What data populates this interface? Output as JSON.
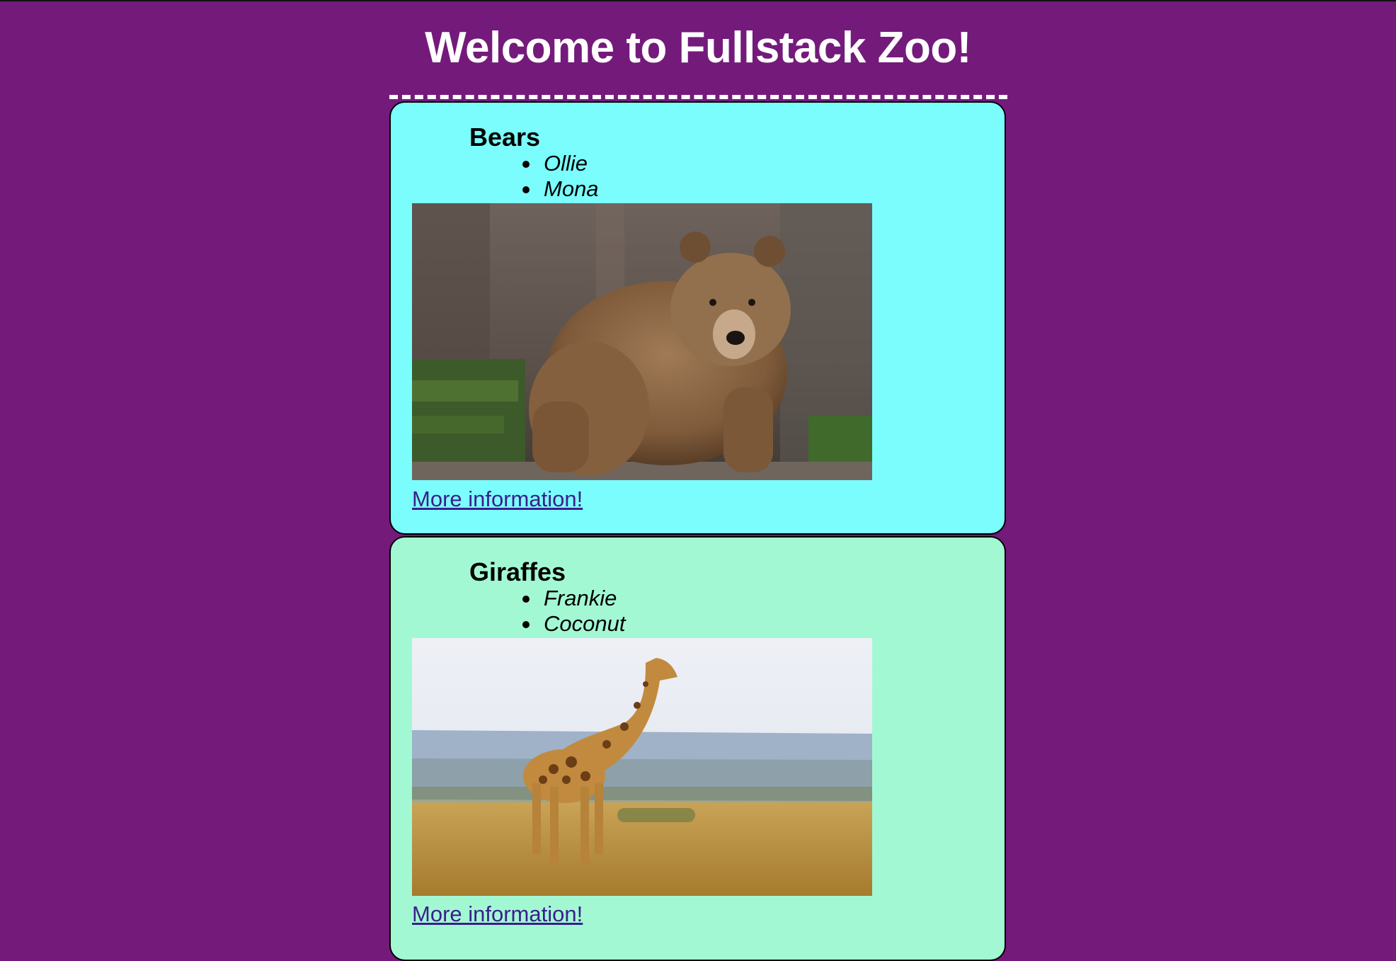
{
  "page": {
    "title": "Welcome to Fullstack Zoo!"
  },
  "colors": {
    "background": "#741a7b",
    "bears_card": "#7bfdfd",
    "giraffes_card": "#a3f8d4",
    "link": "#3a1f8c"
  },
  "exhibits": [
    {
      "heading": "Bears",
      "names": [
        "Ollie",
        "Mona"
      ],
      "image": "brown-bear-photo",
      "link_label": "More information!"
    },
    {
      "heading": "Giraffes",
      "names": [
        "Frankie",
        "Coconut"
      ],
      "image": "giraffe-photo",
      "link_label": "More information!"
    }
  ]
}
